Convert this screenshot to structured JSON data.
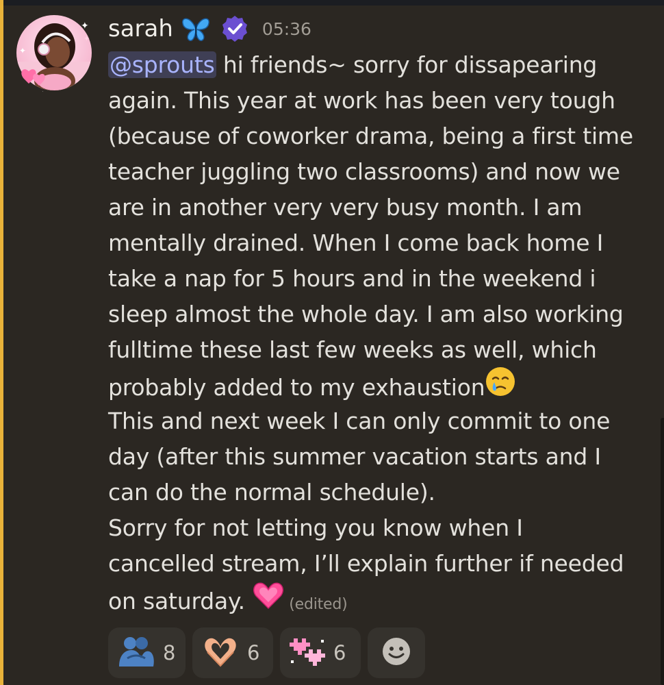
{
  "message": {
    "author": "sarah",
    "timestamp": "05:36",
    "mention": "@sprouts",
    "lines": [
      " hi friends~ sorry for dissapearing",
      "again. This year at work has been very tough",
      "(because of coworker drama, being a first time",
      "teacher juggling two classrooms) and now we",
      "are in another very very busy month. I am",
      "mentally drained. When I come back home I",
      "take a nap for 5 hours and in the weekend i",
      "sleep almost the whole day. I am also working",
      "fulltime these last few weeks as well, which",
      "probably added to my exhaustion",
      "This and next week I can only commit to one",
      "day (after this summer vacation starts and I",
      "can do the normal schedule).",
      "Sorry for not letting you know when I",
      "cancelled stream, I’ll explain further if needed",
      "on saturday. "
    ],
    "edited_label": "(edited)"
  },
  "reactions": [
    {
      "icon": "people-hugging-icon",
      "count": "8"
    },
    {
      "icon": "heart-hands-icon",
      "count": "6"
    },
    {
      "icon": "pixel-hearts-icon",
      "count": "6"
    },
    {
      "icon": "add-reaction-icon"
    }
  ],
  "colors": {
    "background": "#2b2722",
    "highlight": "#e8b23a",
    "mention_bg": "#3f3f55",
    "mention_text": "#a9b4ff",
    "verified": "#6b4fd1",
    "reaction_bg": "#35322d"
  }
}
